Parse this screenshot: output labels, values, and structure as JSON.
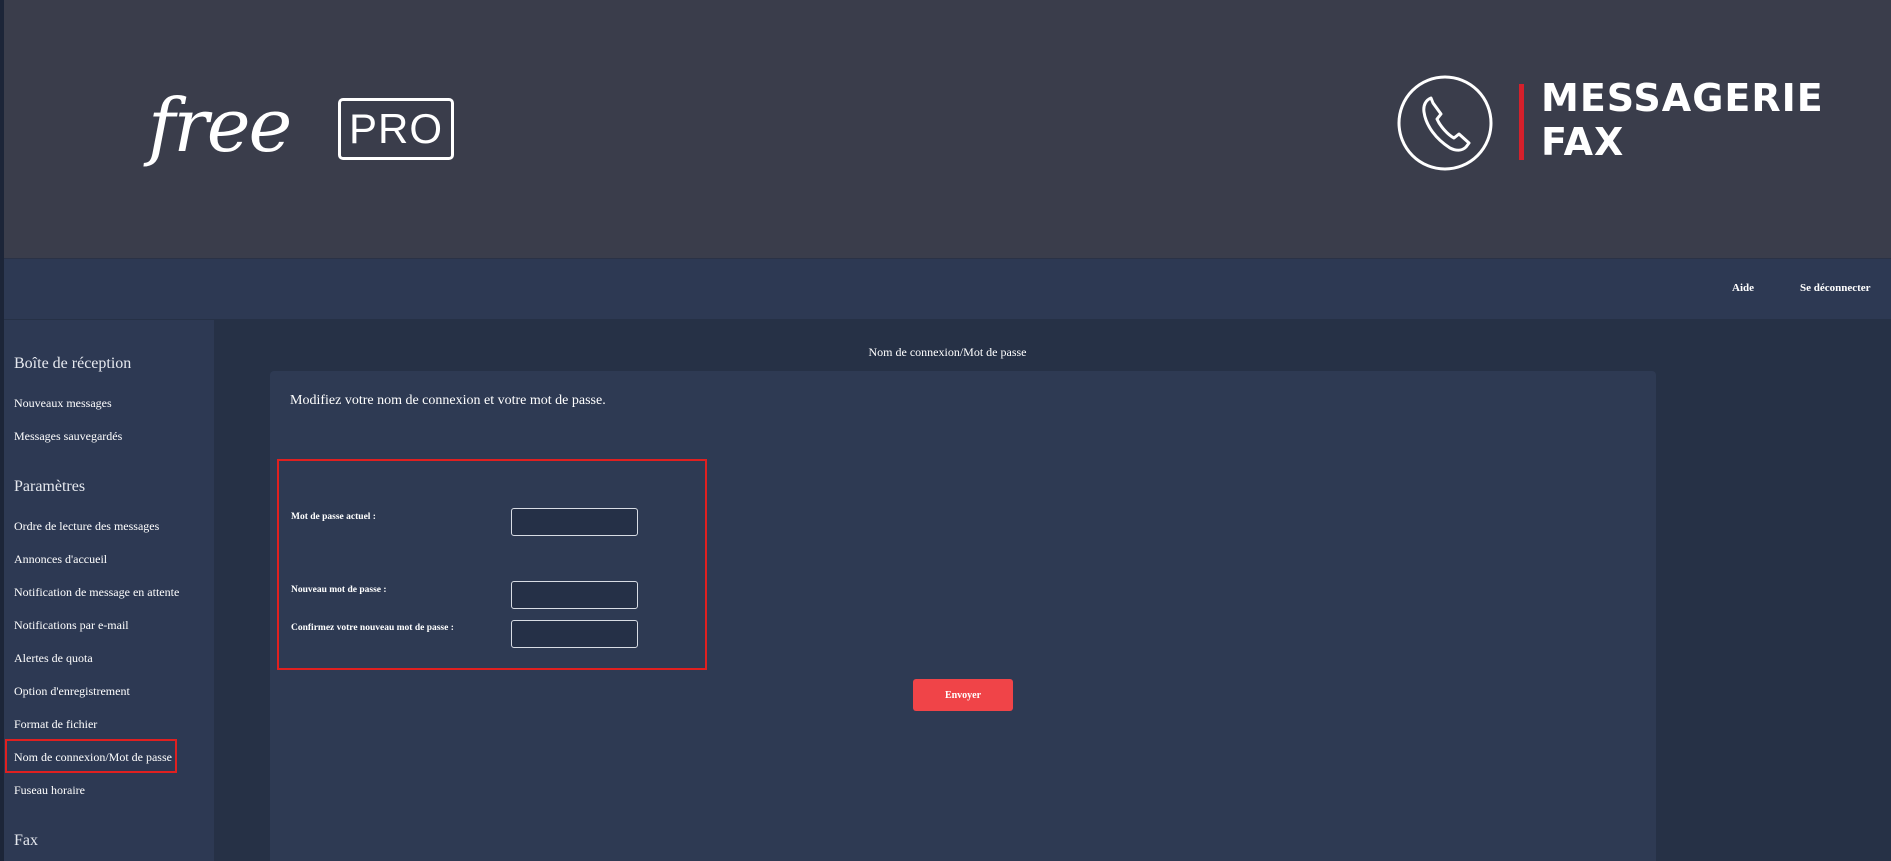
{
  "header": {
    "logo_free": "free",
    "logo_pro": "PRO",
    "brand_line1": "MESSAGERIE",
    "brand_line2": "FAX",
    "brand_icon": "phone-icon"
  },
  "topnav": {
    "help": "Aide",
    "logout": "Se déconnecter"
  },
  "sidebar": {
    "section_inbox": "Boîte de réception",
    "inbox_items": [
      "Nouveaux messages",
      "Messages sauvegardés"
    ],
    "section_settings": "Paramètres",
    "settings_items": [
      "Ordre de lecture des messages",
      "Annonces d'accueil",
      "Notification de message en attente",
      "Notifications par e-mail",
      "Alertes de quota",
      "Option d'enregistrement",
      "Format de fichier",
      "Nom de connexion/Mot de passe",
      "Fuseau horaire"
    ],
    "section_fax": "Fax",
    "selected": "Nom de connexion/Mot de passe"
  },
  "main": {
    "breadcrumb": "Nom de connexion/Mot de passe",
    "title": "Modifiez votre nom de connexion et votre mot de passe.",
    "form": {
      "current_password_label": "Mot de passe actuel :",
      "new_password_label": "Nouveau mot de passe :",
      "confirm_password_label": "Confirmez votre nouveau mot de passe :",
      "current_password_value": "",
      "new_password_value": "",
      "confirm_password_value": ""
    },
    "submit_label": "Envoyer"
  },
  "colors": {
    "header_bg": "#3a3d4b",
    "nav_bg": "#2d3953",
    "page_bg": "#263146",
    "accent_red": "#d5202b",
    "button_bg": "#f04448",
    "highlight_border": "#e02020"
  }
}
